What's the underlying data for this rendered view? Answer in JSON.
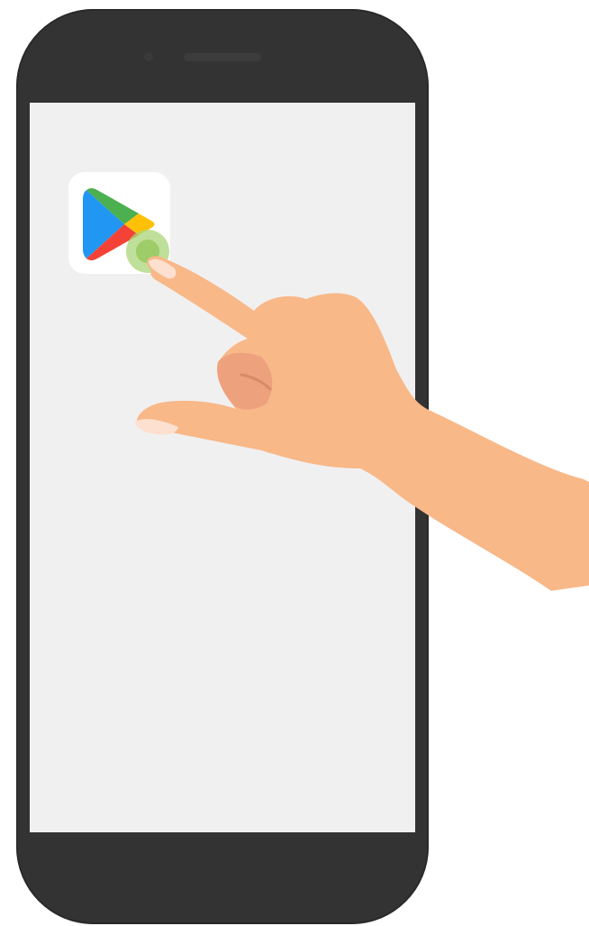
{
  "screen": {
    "background": "#f1f0f1"
  },
  "phone": {
    "body_color": "#333333"
  },
  "app_icon": {
    "icon": "google-play-icon",
    "colors": {
      "blue": "#2196f3",
      "green": "#4caf50",
      "yellow": "#ffc107",
      "red": "#f44336"
    }
  },
  "tap_indicator": {
    "icon": "tap-ripple",
    "color": "#aad678"
  },
  "hand": {
    "icon": "pointing-hand",
    "skin_color": "#f8b888"
  }
}
